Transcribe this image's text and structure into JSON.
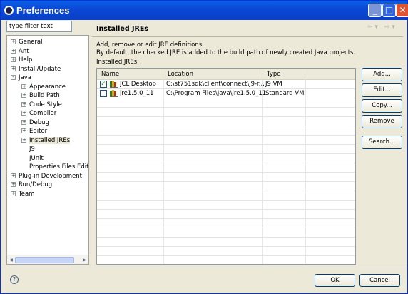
{
  "window": {
    "title": "Preferences"
  },
  "filter": {
    "value": "type filter text"
  },
  "tree": [
    {
      "label": "General",
      "pm": "+"
    },
    {
      "label": "Ant",
      "pm": "+"
    },
    {
      "label": "Help",
      "pm": "+"
    },
    {
      "label": "Install/Update",
      "pm": "+"
    },
    {
      "label": "Java",
      "pm": "-"
    },
    {
      "label": "Appearance",
      "pm": "+"
    },
    {
      "label": "Build Path",
      "pm": "+"
    },
    {
      "label": "Code Style",
      "pm": "+"
    },
    {
      "label": "Compiler",
      "pm": "+"
    },
    {
      "label": "Debug",
      "pm": "+"
    },
    {
      "label": "Editor",
      "pm": "+"
    },
    {
      "label": "Installed JREs",
      "pm": "+"
    },
    {
      "label": "J9",
      "pm": ""
    },
    {
      "label": "JUnit",
      "pm": ""
    },
    {
      "label": "Properties Files Edito",
      "pm": ""
    },
    {
      "label": "Plug-in Development",
      "pm": "+"
    },
    {
      "label": "Run/Debug",
      "pm": "+"
    },
    {
      "label": "Team",
      "pm": "+"
    }
  ],
  "page": {
    "title": "Installed JREs",
    "desc1": "Add, remove or edit JRE definitions.",
    "desc2": "By default, the checked JRE is added to the build path of newly created Java projects.",
    "table_label": "Installed JREs:"
  },
  "table": {
    "headers": [
      "Name",
      "Location",
      "Type"
    ],
    "rows": [
      {
        "checked": true,
        "name": "JCL Desktop",
        "location": "C:\\st751sdk\\client\\connect\\j9-r...",
        "type": "J9 VM"
      },
      {
        "checked": false,
        "name": "jre1.5.0_11",
        "location": "C:\\Program Files\\Java\\jre1.5.0_11",
        "type": "Standard VM"
      }
    ]
  },
  "buttons": {
    "add": "Add...",
    "edit": "Edit...",
    "copy": "Copy...",
    "remove": "Remove",
    "search": "Search...",
    "ok": "OK",
    "cancel": "Cancel"
  },
  "icons": {
    "help": "help-icon",
    "back": "back-arrow-icon",
    "forward": "forward-arrow-icon"
  }
}
